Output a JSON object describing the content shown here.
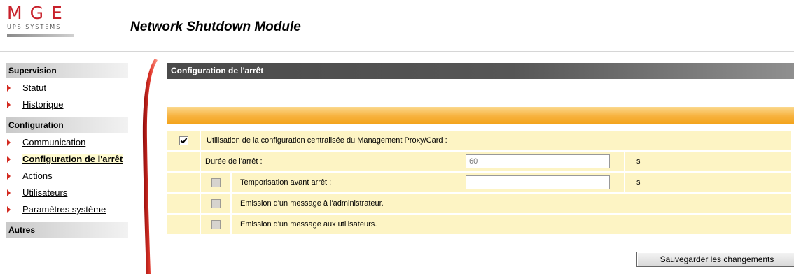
{
  "brand": {
    "logo_text": "MGE",
    "logo_sub": "UPS SYSTEMS"
  },
  "app_title": "Network  Shutdown  Module",
  "sidebar": {
    "groups": [
      {
        "title": "Supervision",
        "items": [
          {
            "label": "Statut"
          },
          {
            "label": "Historique"
          }
        ]
      },
      {
        "title": "Configuration",
        "items": [
          {
            "label": "Communication"
          },
          {
            "label": "Configuration de l'arrêt",
            "active": true
          },
          {
            "label": "Actions"
          },
          {
            "label": "Utilisateurs"
          },
          {
            "label": "Paramètres système"
          }
        ]
      },
      {
        "title": "Autres",
        "items": []
      }
    ]
  },
  "main": {
    "title": "Configuration de l'arrêt",
    "rows": [
      {
        "label": "Utilisation de la configuration centralisée du Management Proxy/Card :",
        "checked": true
      },
      {
        "label": "Durée de l'arrêt :",
        "value": "60",
        "unit": "s"
      },
      {
        "label": "Temporisation avant arrêt :",
        "value": "",
        "unit": "s",
        "checked": false
      },
      {
        "label": "Emission d'un message à l'administrateur.",
        "checked": false
      },
      {
        "label": "Emission d'un message aux utilisateurs.",
        "checked": false
      }
    ],
    "save_label": "Sauvegarder les changements"
  },
  "colors": {
    "accent_red": "#d32a20",
    "row_bg": "#fdf4c4",
    "orange": "#f7b23e",
    "title_bar": "#4a4a4a"
  }
}
